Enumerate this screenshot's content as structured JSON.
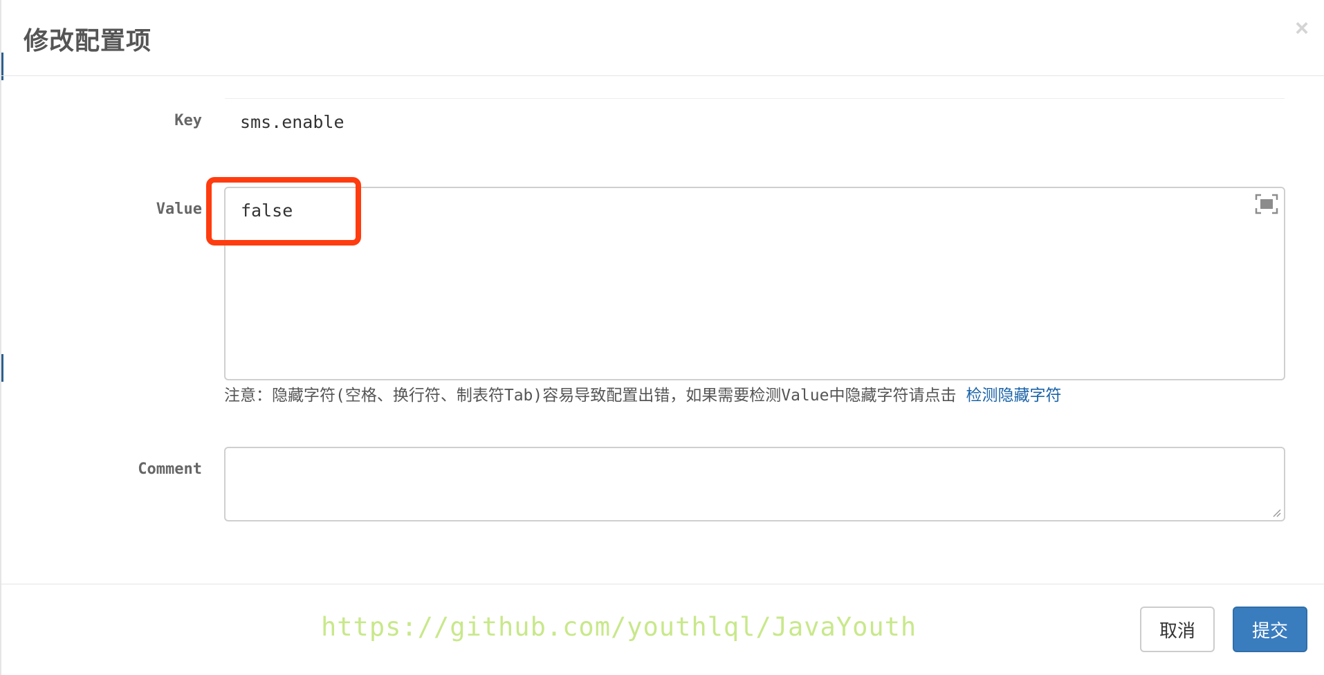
{
  "dialog": {
    "title": "修改配置项",
    "close_symbol": "×"
  },
  "form": {
    "key_label": "Key",
    "key_value": "sms.enable",
    "value_label": "Value",
    "value_text": "false",
    "hint_text": "注意：隐藏字符(空格、换行符、制表符Tab)容易导致配置出错，如果需要检测Value中隐藏字符请点击",
    "hint_link": "检测隐藏字符",
    "comment_label": "Comment",
    "comment_text": ""
  },
  "footer": {
    "watermark": "https://github.com/youthlql/JavaYouth",
    "cancel_label": "取消",
    "submit_label": "提交"
  },
  "colors": {
    "highlight": "#ff3c0f",
    "primary": "#3a7dbf",
    "link": "#1a63a8",
    "watermark": "#c8e88a"
  },
  "icons": {
    "close": "close-icon",
    "fullscreen": "fullscreen-icon",
    "resize": "resize-grip-icon"
  }
}
